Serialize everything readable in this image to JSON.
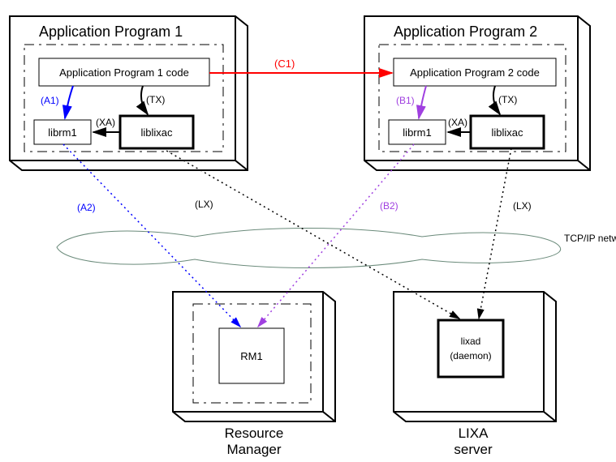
{
  "title_ap1": "Application Program 1",
  "title_ap2": "Application Program 2",
  "code_ap1": "Application Program 1 code",
  "code_ap2": "Application Program 2 code",
  "librm1": "librm1",
  "liblixac": "liblixac",
  "rm1": "RM1",
  "lixad_line1": "lixad",
  "lixad_line2": "(daemon)",
  "rm_title_l1": "Resource",
  "rm_title_l2": "Manager",
  "lixa_title_l1": "LIXA",
  "lixa_title_l2": "server",
  "network": "TCP/IP network",
  "labels": {
    "A1": "(A1)",
    "A2": "(A2)",
    "B1": "(B1)",
    "B2": "(B2)",
    "C1": "(C1)",
    "TX": "(TX)",
    "XA": "(XA)",
    "LX": "(LX)"
  },
  "colors": {
    "black": "#000000",
    "red": "#ff0000",
    "blue": "#0000ff",
    "purple": "#a040e0",
    "cloud": "#6a8a7a"
  }
}
